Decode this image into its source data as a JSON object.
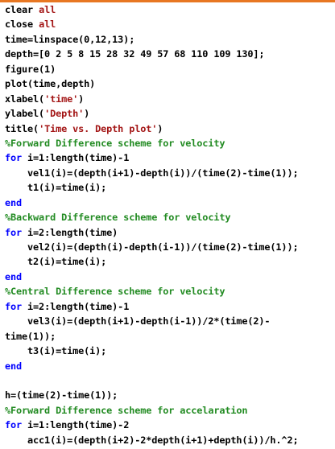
{
  "colors": {
    "code": "#000000",
    "keyword": "#0000ff",
    "string": "#a31515",
    "comment": "#228b22",
    "background": "#ffffff",
    "top_strip": "#e87722"
  },
  "lines": [
    [
      {
        "t": "code",
        "s": "clear "
      },
      {
        "t": "string",
        "s": "all"
      }
    ],
    [
      {
        "t": "code",
        "s": "close "
      },
      {
        "t": "string",
        "s": "all"
      }
    ],
    [
      {
        "t": "code",
        "s": "time=linspace(0,12,13);"
      }
    ],
    [
      {
        "t": "code",
        "s": "depth=[0 2 5 8 15 28 32 49 57 68 110 109 130];"
      }
    ],
    [
      {
        "t": "code",
        "s": "figure(1)"
      }
    ],
    [
      {
        "t": "code",
        "s": "plot(time,depth)"
      }
    ],
    [
      {
        "t": "code",
        "s": "xlabel("
      },
      {
        "t": "string",
        "s": "'time'"
      },
      {
        "t": "code",
        "s": ")"
      }
    ],
    [
      {
        "t": "code",
        "s": "ylabel("
      },
      {
        "t": "string",
        "s": "'Depth'"
      },
      {
        "t": "code",
        "s": ")"
      }
    ],
    [
      {
        "t": "code",
        "s": "title("
      },
      {
        "t": "string",
        "s": "'Time vs. Depth plot'"
      },
      {
        "t": "code",
        "s": ")"
      }
    ],
    [
      {
        "t": "comment",
        "s": "%Forward Difference scheme for velocity"
      }
    ],
    [
      {
        "t": "keyword",
        "s": "for"
      },
      {
        "t": "code",
        "s": " i=1:length(time)-1"
      }
    ],
    [
      {
        "t": "code",
        "s": "    vel1(i)=(depth(i+1)-depth(i))/(time(2)-time(1));"
      }
    ],
    [
      {
        "t": "code",
        "s": "    t1(i)=time(i);"
      }
    ],
    [
      {
        "t": "keyword",
        "s": "end"
      }
    ],
    [
      {
        "t": "comment",
        "s": "%Backward Difference scheme for velocity"
      }
    ],
    [
      {
        "t": "keyword",
        "s": "for"
      },
      {
        "t": "code",
        "s": " i=2:length(time)"
      }
    ],
    [
      {
        "t": "code",
        "s": "    vel2(i)=(depth(i)-depth(i-1))/(time(2)-time(1));"
      }
    ],
    [
      {
        "t": "code",
        "s": "    t2(i)=time(i);"
      }
    ],
    [
      {
        "t": "keyword",
        "s": "end"
      }
    ],
    [
      {
        "t": "comment",
        "s": "%Central Difference scheme for velocity"
      }
    ],
    [
      {
        "t": "keyword",
        "s": "for"
      },
      {
        "t": "code",
        "s": " i=2:length(time)-1"
      }
    ],
    [
      {
        "t": "code",
        "s": "    vel3(i)=(depth(i+1)-depth(i-1))/2*(time(2)-"
      }
    ],
    [
      {
        "t": "code",
        "s": "time(1));"
      }
    ],
    [
      {
        "t": "code",
        "s": "    t3(i)=time(i);"
      }
    ],
    [
      {
        "t": "keyword",
        "s": "end"
      }
    ],
    [
      {
        "t": "code",
        "s": ""
      }
    ],
    [
      {
        "t": "code",
        "s": "h=(time(2)-time(1));"
      }
    ],
    [
      {
        "t": "comment",
        "s": "%Forward Difference scheme for accelaration"
      }
    ],
    [
      {
        "t": "keyword",
        "s": "for"
      },
      {
        "t": "code",
        "s": " i=1:length(time)-2"
      }
    ],
    [
      {
        "t": "code",
        "s": "    acc1(i)=(depth(i+2)-2*depth(i+1)+depth(i))/h.^2;"
      }
    ]
  ]
}
